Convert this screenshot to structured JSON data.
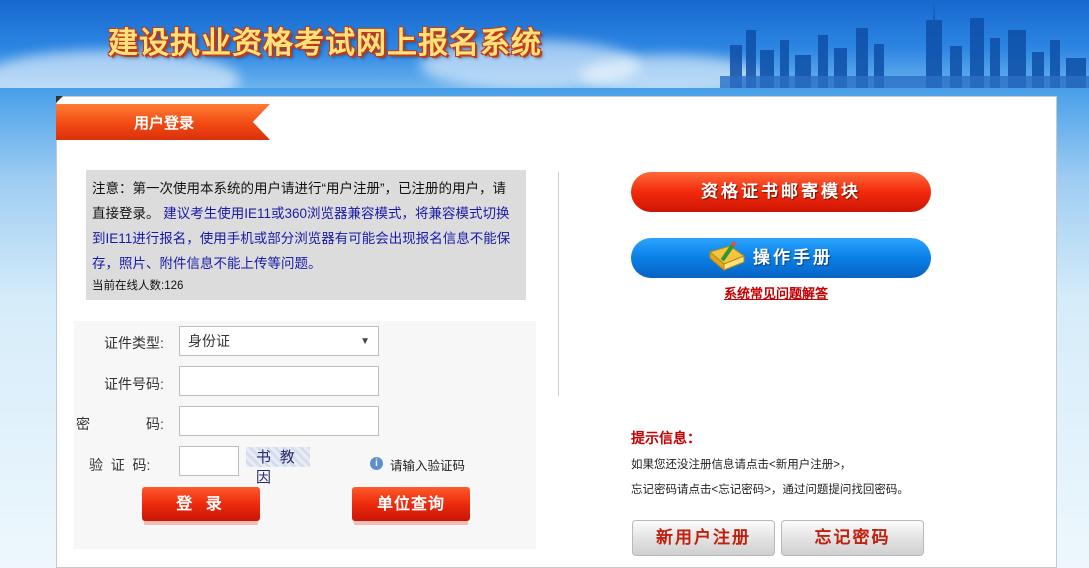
{
  "header": {
    "title": "建设执业资格考试网上报名系统"
  },
  "login_tab": {
    "label": "用户登录"
  },
  "notice": {
    "text_part1": "注意：第一次使用本系统的用户请进行“用户注册”，已注册的用户，请直接登录。",
    "text_part2": "建议考生使用IE11或360浏览器兼容模式，将兼容模式切换到IE11进行报名，使用手机或部分浏览器有可能会出现报名信息不能保存，照片、附件信息不能上传等问题。",
    "online_label": "当前在线人数:",
    "online_count": "126"
  },
  "form": {
    "id_type_label": "证件类型:",
    "id_type_value": "身份证",
    "id_number_label": "证件号码:",
    "id_number_value": "",
    "password_label_a": "密",
    "password_label_b": "码:",
    "password_value": "",
    "captcha_label": "验  证  码:",
    "captcha_value": "",
    "captcha_image_text": "书 教因",
    "captcha_hint": "请输入验证码",
    "login_button": "登 录",
    "unit_query_button": "单位查询"
  },
  "right_panel": {
    "certificate_mail_button": "资格证书邮寄模块",
    "manual_button": "操作手册",
    "faq_link": "系统常见问题解答",
    "tips_title": "提示信息：",
    "tips_line1": "如果您还没注册信息请点击<新用户注册>，",
    "tips_line2": "忘记密码请点击<忘记密码>，通过问题提问找回密码。",
    "register_button": "新用户注册",
    "forgot_button": "忘记密码"
  },
  "colors": {
    "accent_red": "#ed2a0c",
    "accent_blue": "#0a7fe6",
    "link_red": "#c40000"
  }
}
